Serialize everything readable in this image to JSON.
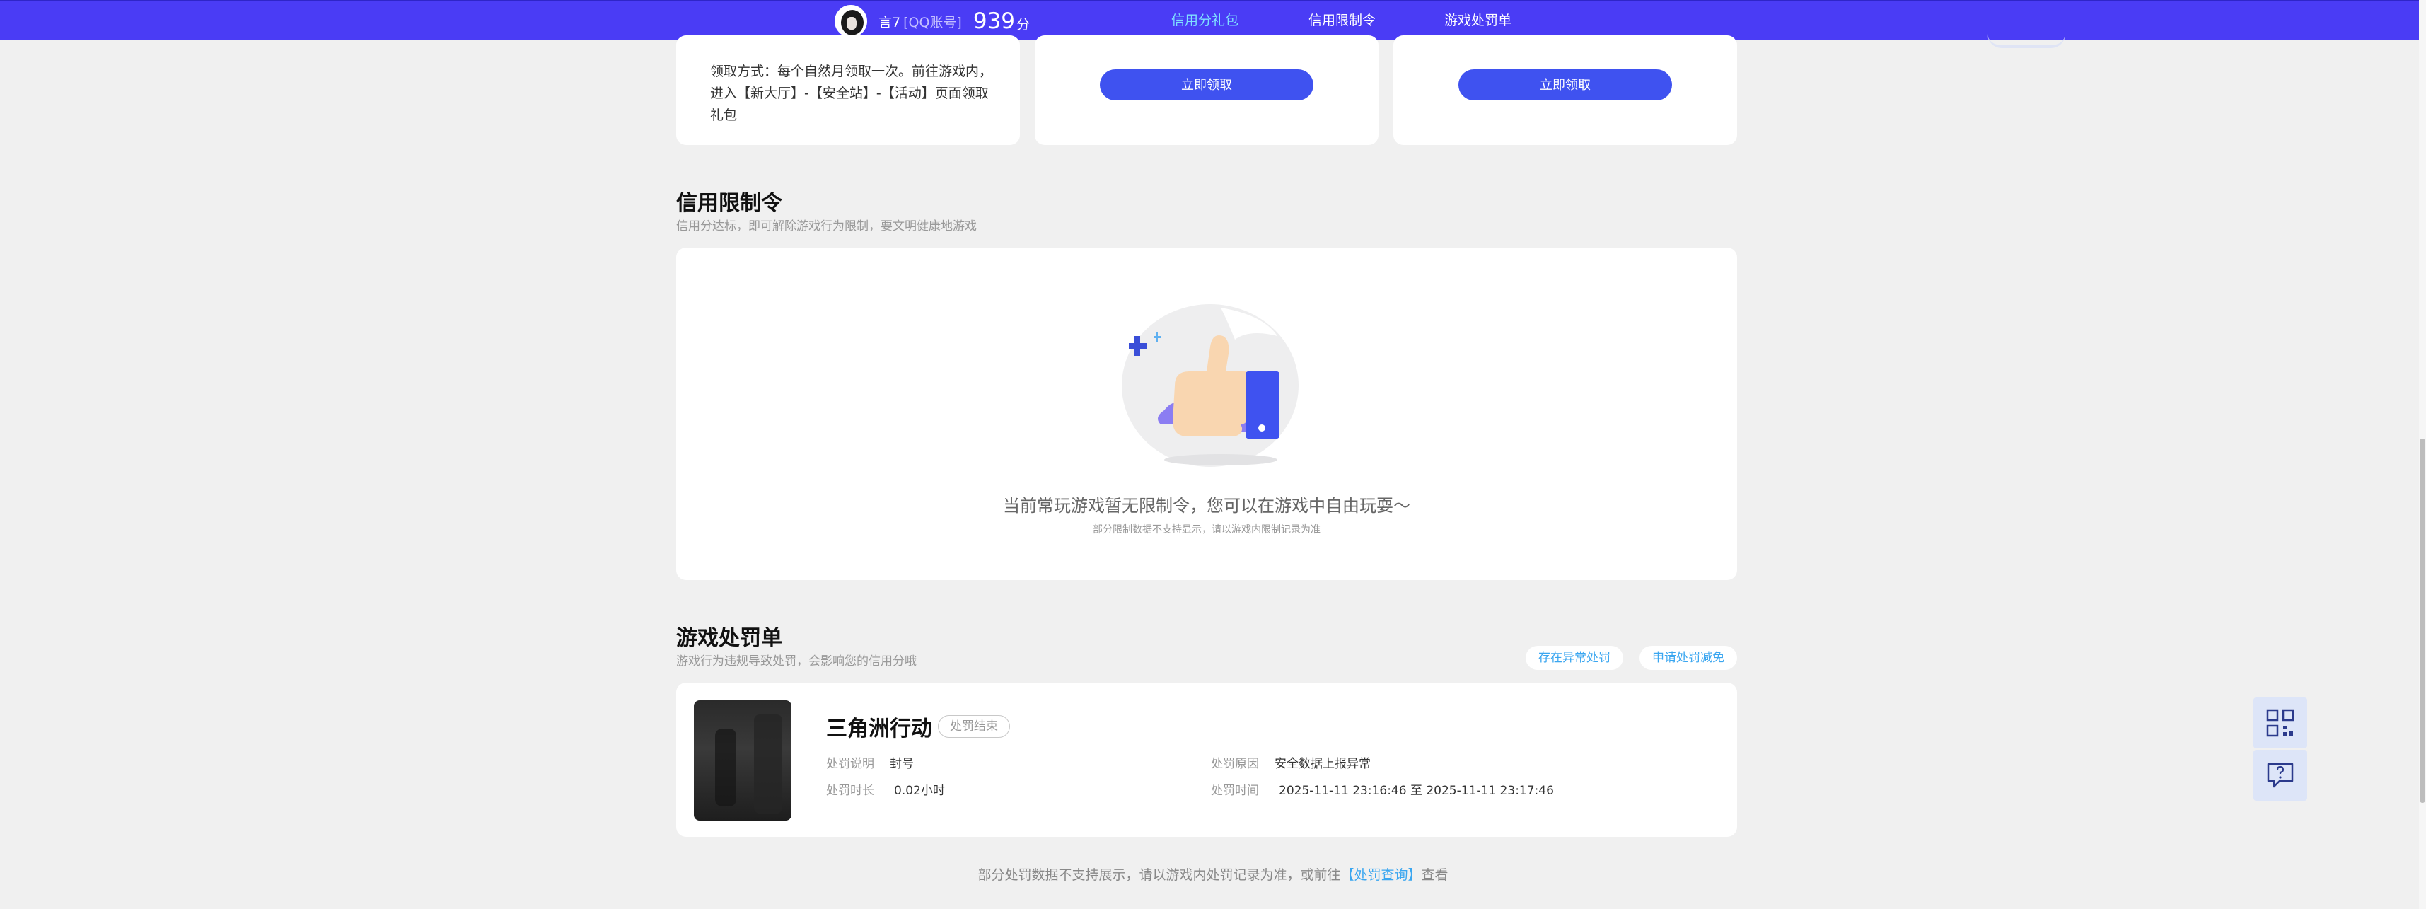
{
  "header": {
    "user_name": "言7",
    "account_type": "[QQ账号]",
    "score": "939",
    "score_unit": "分",
    "tabs": [
      {
        "label": "信用分礼包",
        "active": true
      },
      {
        "label": "信用限制令",
        "active": false
      },
      {
        "label": "游戏处罚单",
        "active": false
      }
    ]
  },
  "gifts": {
    "claim_method": "领取方式：每个自然月领取一次。前往游戏内，进入【新大厅】-【安全站】-【活动】页面领取礼包",
    "claim_button_1": "立即领取",
    "claim_button_2": "立即领取"
  },
  "restrictions": {
    "title": "信用限制令",
    "subtitle": "信用分达标，即可解除游戏行为限制，要文明健康地游戏",
    "empty_title": "当前常玩游戏暂无限制令，您可以在游戏中自由玩耍～",
    "empty_sub": "部分限制数据不支持显示，请以游戏内限制记录为准"
  },
  "penalties": {
    "title": "游戏处罚单",
    "subtitle": "游戏行为违规导致处罚，会影响您的信用分哦",
    "abnormal_button": "存在异常处罚",
    "reduce_button": "申请处罚减免",
    "items": [
      {
        "game": "三角洲行动",
        "status": "处罚结束",
        "desc_label": "处罚说明",
        "desc_value": "封号",
        "duration_label": "处罚时长",
        "duration_value": "0.02小时",
        "reason_label": "处罚原因",
        "reason_value": "安全数据上报异常",
        "time_label": "处罚时间",
        "time_value": "2025-11-11 23:16:46 至 2025-11-11 23:17:46"
      }
    ]
  },
  "footer": {
    "note_prefix": "部分处罚数据不支持展示，请以游戏内处罚记录为准，或前往",
    "link": "【处罚查询】",
    "note_suffix": "查看"
  },
  "colors": {
    "topbar": "#4a3cf5",
    "primary_button": "#3f52f0",
    "link": "#3aa6f0",
    "page_bg": "#f0f0f0"
  },
  "icons": [
    "qr-code-icon",
    "feedback-icon",
    "thumbs-up-illustration"
  ]
}
